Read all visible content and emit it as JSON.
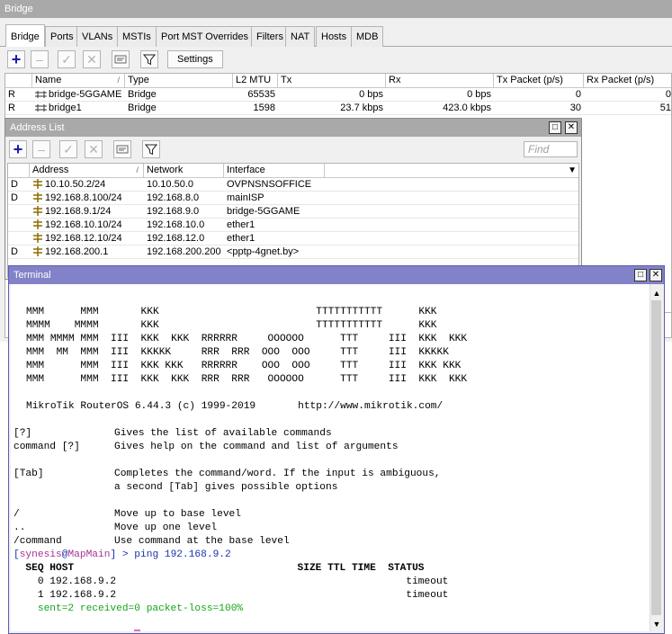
{
  "bridge": {
    "title": "Bridge",
    "tabs": [
      "Bridge",
      "Ports",
      "VLANs",
      "MSTIs",
      "Port MST Overrides",
      "Filters",
      "NAT",
      "Hosts",
      "MDB"
    ],
    "settings_label": "Settings",
    "columns": [
      "",
      "Name",
      "Type",
      "L2 MTU",
      "Tx",
      "Rx",
      "Tx Packet (p/s)",
      "Rx Packet (p/s)"
    ],
    "rows": [
      {
        "flag": "R",
        "name": "bridge-5GGAME",
        "type": "Bridge",
        "l2mtu": "65535",
        "tx": "0 bps",
        "rx": "0 bps",
        "txp": "0",
        "rxp": "0"
      },
      {
        "flag": "R",
        "name": "bridge1",
        "type": "Bridge",
        "l2mtu": "1598",
        "tx": "23.7 kbps",
        "rx": "423.0 kbps",
        "txp": "30",
        "rxp": "51"
      }
    ]
  },
  "address_list": {
    "title": "Address List",
    "find_placeholder": "Find",
    "columns": [
      "Address",
      "Network",
      "Interface"
    ],
    "rows": [
      {
        "flag": "D",
        "address": "10.10.50.2/24",
        "network": "10.10.50.0",
        "interface": "OVPNSNSOFFICE"
      },
      {
        "flag": "D",
        "address": "192.168.8.100/24",
        "network": "192.168.8.0",
        "interface": "mainISP"
      },
      {
        "flag": "",
        "address": "192.168.9.1/24",
        "network": "192.168.9.0",
        "interface": "bridge-5GGAME"
      },
      {
        "flag": "",
        "address": "192.168.10.10/24",
        "network": "192.168.10.0",
        "interface": "ether1"
      },
      {
        "flag": "",
        "address": "192.168.12.10/24",
        "network": "192.168.12.0",
        "interface": "ether1"
      },
      {
        "flag": "D",
        "address": "192.168.200.1",
        "network": "192.168.200.200",
        "interface": "<pptp-4gnet.by>"
      }
    ]
  },
  "terminal": {
    "title": "Terminal",
    "banner": [
      "MMM      MMM       KKK                          TTTTTTTTTTT      KKK",
      "MMMM    MMMM       KKK                          TTTTTTTTTTT      KKK",
      "MMM MMMM MMM  III  KKK  KKK  RRRRRR     OOOOOO      TTT     III  KKK  KKK",
      "MMM  MM  MMM  III  KKKKK     RRR  RRR  OOO  OOO     TTT     III  KKKKK",
      "MMM      MMM  III  KKK KKK   RRRRRR    OOO  OOO     TTT     III  KKK KKK",
      "MMM      MMM  III  KKK  KKK  RRR  RRR   OOOOOO      TTT     III  KKK  KKK"
    ],
    "version_line": "MikroTik RouterOS 6.44.3 (c) 1999-2019       http://www.mikrotik.com/",
    "help": [
      {
        "key": "[?]",
        "desc": "Gives the list of available commands"
      },
      {
        "key": "command [?]",
        "desc": "Gives help on the command and list of arguments"
      },
      {
        "key": "",
        "desc": ""
      },
      {
        "key": "[Tab]",
        "desc": "Completes the command/word. If the input is ambiguous,"
      },
      {
        "key": "",
        "desc": "a second [Tab] gives possible options"
      },
      {
        "key": "",
        "desc": ""
      },
      {
        "key": "/",
        "desc": "Move up to base level"
      },
      {
        "key": "..",
        "desc": "Move up one level"
      },
      {
        "key": "/command",
        "desc": "Use command at the base level"
      }
    ],
    "prompt_open": "[",
    "prompt_user": "synesis",
    "prompt_at": "@",
    "prompt_host": "MapMain",
    "prompt_close": "] > ",
    "command": "ping 192.168.9.2",
    "ping_header": "  SEQ HOST                                     SIZE TTL TIME  STATUS",
    "ping_rows": [
      "    0 192.168.9.2                                                timeout",
      "    1 192.168.9.2                                                timeout"
    ],
    "summary": "    sent=2 received=0 packet-loss=100%"
  }
}
